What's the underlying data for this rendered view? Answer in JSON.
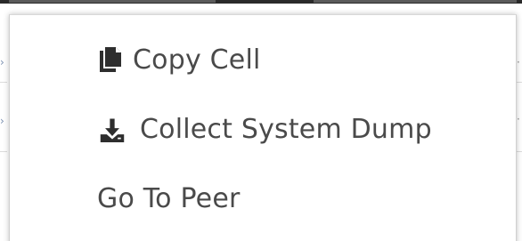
{
  "context_menu": {
    "items": [
      {
        "label": "Copy Cell",
        "icon": "copy-icon"
      },
      {
        "label": "Collect System Dump",
        "icon": "download-icon"
      },
      {
        "label": "Go To Peer",
        "icon": ""
      }
    ]
  },
  "colors": {
    "menu_text": "#4a4a4a",
    "icon": "#2e2e2e",
    "menu_border": "#d0d0d0"
  }
}
